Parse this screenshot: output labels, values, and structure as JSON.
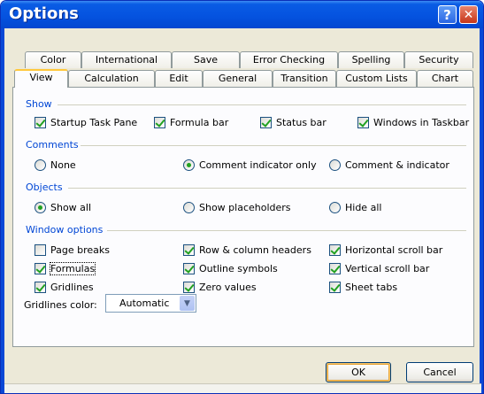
{
  "window": {
    "title": "Options"
  },
  "titlebar": {
    "help_glyph": "?",
    "close_glyph": "✕"
  },
  "tabs_row1": [
    "Color",
    "International",
    "Save",
    "Error Checking",
    "Spelling",
    "Security"
  ],
  "tabs_row2": [
    "View",
    "Calculation",
    "Edit",
    "General",
    "Transition",
    "Custom Lists",
    "Chart"
  ],
  "active_tab": "View",
  "show": {
    "label": "Show",
    "startup": {
      "label": "Startup Task Pane",
      "checked": true
    },
    "formula_bar": {
      "label": "Formula bar",
      "checked": true
    },
    "status_bar": {
      "label": "Status bar",
      "checked": true
    },
    "windows_taskbar": {
      "label": "Windows in Taskbar",
      "checked": true
    }
  },
  "comments": {
    "label": "Comments",
    "none": "None",
    "indicator_only": "Comment indicator only",
    "comment_indicator": "Comment & indicator",
    "selected": "indicator_only"
  },
  "objects": {
    "label": "Objects",
    "show_all": "Show all",
    "show_placeholders": "Show placeholders",
    "hide_all": "Hide all",
    "selected": "show_all"
  },
  "window_options": {
    "label": "Window options",
    "page_breaks": {
      "label": "Page breaks",
      "checked": false
    },
    "formulas": {
      "label": "Formulas",
      "checked": true
    },
    "gridlines": {
      "label": "Gridlines",
      "checked": true
    },
    "row_col_headers": {
      "label": "Row & column headers",
      "checked": true
    },
    "outline_symbols": {
      "label": "Outline symbols",
      "checked": true
    },
    "zero_values": {
      "label": "Zero values",
      "checked": true
    },
    "h_scroll": {
      "label": "Horizontal scroll bar",
      "checked": true
    },
    "v_scroll": {
      "label": "Vertical scroll bar",
      "checked": true
    },
    "sheet_tabs": {
      "label": "Sheet tabs",
      "checked": true
    },
    "gridlines_color_label": "Gridlines color:",
    "gridlines_color_value": "Automatic"
  },
  "buttons": {
    "ok": "OK",
    "cancel": "Cancel"
  },
  "colors": {
    "title_blue": "#0553e0",
    "group_label": "#0046d5",
    "check_green": "#21a121",
    "dialog_bg": "#ece9d8"
  }
}
